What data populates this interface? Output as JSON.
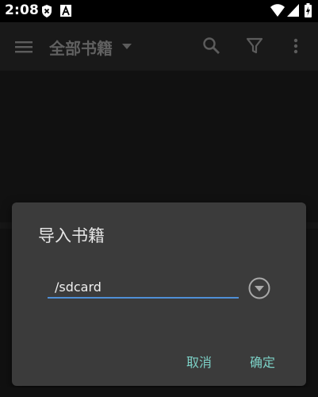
{
  "status_bar": {
    "time": "2:08",
    "icons": [
      "shield-x-icon",
      "a-badge-icon",
      "wifi-icon",
      "signal-icon",
      "battery-charging-icon"
    ]
  },
  "app_bar": {
    "title": "全部书籍",
    "icons": [
      "menu-icon",
      "chevron-down-icon",
      "search-icon",
      "filter-icon",
      "more-vert-icon"
    ]
  },
  "dialog": {
    "title": "导入书籍",
    "path_value": "/sdcard",
    "cancel_label": "取消",
    "ok_label": "确定"
  },
  "colors": {
    "accent": "#7cd0c6",
    "input_underline": "#4f8fd6",
    "dialog_bg": "#3b3b3b",
    "app_bar_bg": "#191919"
  }
}
